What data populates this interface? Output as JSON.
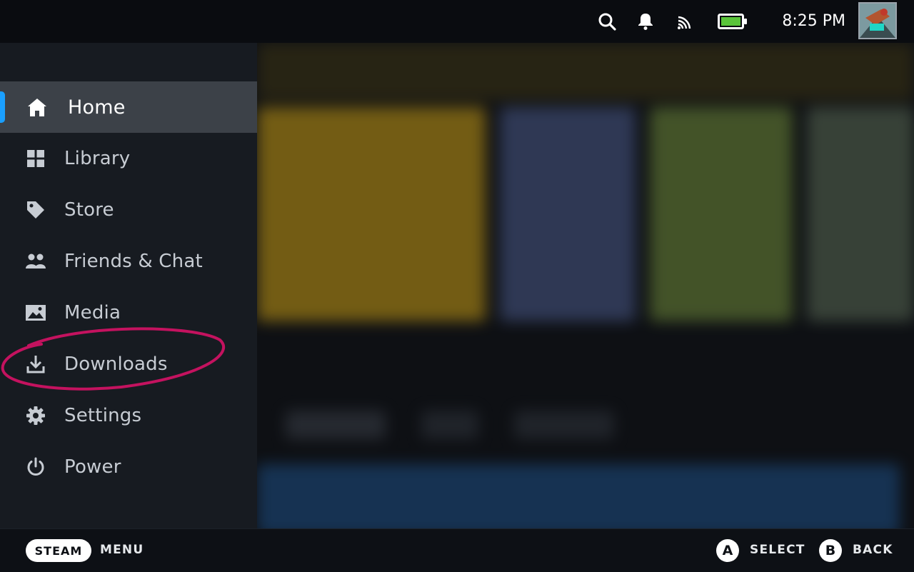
{
  "status": {
    "time": "8:25 PM",
    "icons": [
      "search-icon",
      "notification-bell-icon",
      "cast-icon",
      "battery-icon"
    ],
    "battery_color": "#5ac43a"
  },
  "sidebar": {
    "accent_color": "#1a9fff",
    "items": [
      {
        "label": "Home",
        "icon": "home-icon"
      },
      {
        "label": "Library",
        "icon": "library-grid-icon"
      },
      {
        "label": "Store",
        "icon": "store-tag-icon"
      },
      {
        "label": "Friends & Chat",
        "icon": "friends-icon"
      },
      {
        "label": "Media",
        "icon": "media-image-icon"
      },
      {
        "label": "Downloads",
        "icon": "download-icon"
      },
      {
        "label": "Settings",
        "icon": "settings-gear-icon"
      },
      {
        "label": "Power",
        "icon": "power-icon"
      }
    ],
    "active_index": 0
  },
  "annotation": {
    "color": "#c4125f",
    "target": "Downloads"
  },
  "bottom": {
    "steam_label": "STEAM",
    "menu_label": "MENU",
    "a_key": "A",
    "select_label": "SELECT",
    "b_key": "B",
    "back_label": "BACK"
  }
}
